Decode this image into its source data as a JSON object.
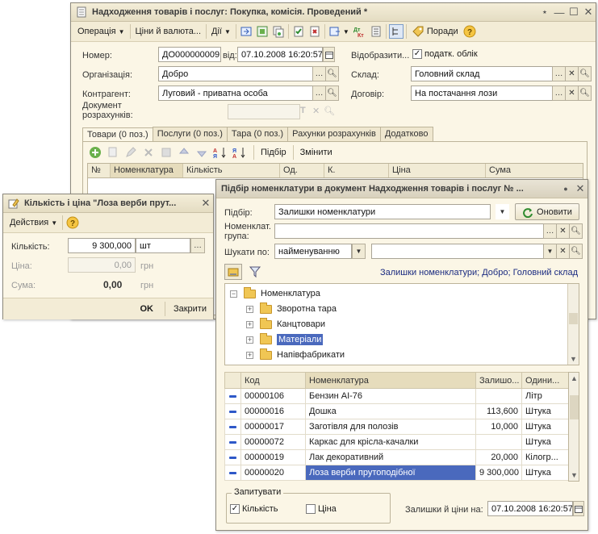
{
  "main_window": {
    "title": "Надходження товарів і послуг: Покупка, комісія. Проведений *",
    "toolbar": {
      "operation": "Операція",
      "prices": "Ціни й валюта...",
      "actions": "Дії",
      "tips": "Поради"
    },
    "form": {
      "number_label": "Номер:",
      "number_value": "ДО000000009",
      "from_label": "від:",
      "date_value": "07.10.2008 16:20:57",
      "reflect_label": "Відобразити...",
      "tax_accounting_label": "податк. облік",
      "org_label": "Організація:",
      "org_value": "Добро",
      "warehouse_label": "Склад:",
      "warehouse_value": "Головний склад",
      "contractor_label": "Контрагент:",
      "contractor_value": "Луговий - приватна особа",
      "contract_label": "Договір:",
      "contract_value": "На постачання лози",
      "settlement_doc_label": "Документ розрахунків:"
    },
    "tabs": [
      "Товари (0 поз.)",
      "Послуги (0 поз.)",
      "Тара (0 поз.)",
      "Рахунки розрахунків",
      "Додатково"
    ],
    "grid_toolbar": {
      "selection": "Підбір",
      "change": "Змінити"
    },
    "grid_columns": [
      "№",
      "Номенклатура",
      "Кількість",
      "Од.",
      "К.",
      "Ціна",
      "Сума"
    ]
  },
  "qty_dialog": {
    "title": "Кількість і ціна \"Лоза верби прут...",
    "actions_menu": "Действия",
    "qty_label": "Кількість:",
    "qty_value": "9 300,000",
    "unit_value": "шт",
    "price_label": "Ціна:",
    "price_value": "0,00",
    "price_currency": "грн",
    "sum_label": "Сума:",
    "sum_value": "0,00",
    "sum_currency": "грн",
    "ok_button": "OK",
    "close_button": "Закрити"
  },
  "selection_window": {
    "title": "Підбір номенклатури в документ Надходження товарів і послуг № ...",
    "selection_label": "Підбір:",
    "selection_value": "Залишки номенклатури",
    "refresh_button": "Оновити",
    "group_label": "Номенклат. група:",
    "search_label": "Шукати по:",
    "search_by_value": "найменуванню",
    "info_link": "Залишки номенклатури; Добро; Головний склад",
    "tree": {
      "root": "Номенклатура",
      "children": [
        "Зворотна тара",
        "Канцтовари",
        "Матеріали",
        "Напівфабрикати"
      ],
      "selected_index": 2
    },
    "columns": [
      "Код",
      "Номенклатура",
      "Залишо...",
      "Одини..."
    ],
    "rows": [
      {
        "code": "00000106",
        "name": "Бензин АІ-76",
        "rest": "",
        "unit": "Літр"
      },
      {
        "code": "00000016",
        "name": "Дошка",
        "rest": "113,600",
        "unit": "Штука"
      },
      {
        "code": "00000017",
        "name": "Заготівля для полозів",
        "rest": "10,000",
        "unit": "Штука"
      },
      {
        "code": "00000072",
        "name": "Каркас для крісла-качалки",
        "rest": "",
        "unit": "Штука"
      },
      {
        "code": "00000019",
        "name": "Лак декоративний",
        "rest": "20,000",
        "unit": "Кілогр..."
      },
      {
        "code": "00000020",
        "name": "Лоза верби прутоподібної",
        "rest": "9 300,000",
        "unit": "Штука"
      }
    ],
    "selected_row": 5,
    "ask_group": {
      "legend": "Запитувати",
      "qty_label": "Кількість",
      "qty_checked": true,
      "price_label": "Ціна",
      "price_checked": false
    },
    "rests_label": "Залишки й ціни на:",
    "rests_date": "07.10.2008 16:20:57"
  }
}
